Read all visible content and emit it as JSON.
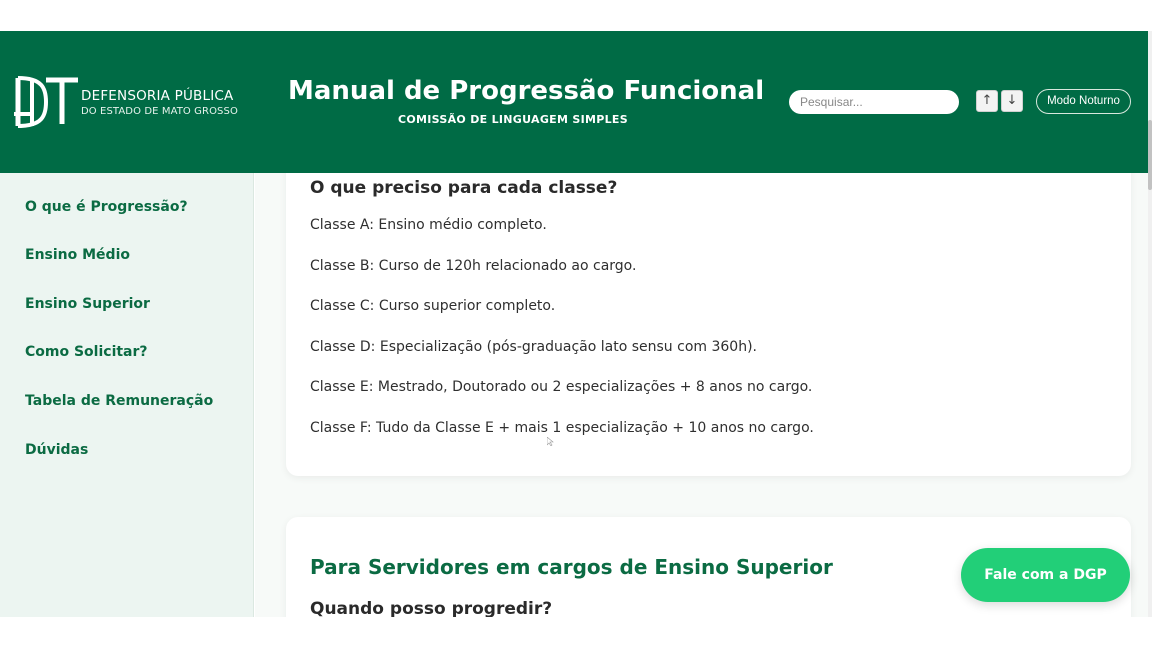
{
  "header": {
    "logo_line1": "DEFENSORIA PÚBLICA",
    "logo_line2": "DO ESTADO DE MATO GROSSO",
    "title": "Manual de Progressão Funcional",
    "subtitle": "COMISSÃO DE LINGUAGEM SIMPLES",
    "search_placeholder": "Pesquisar...",
    "up_label": "↑",
    "down_label": "↓",
    "night_mode_label": "Modo Noturno"
  },
  "sidebar": {
    "items": [
      {
        "label": "O que é Progressão?"
      },
      {
        "label": "Ensino Médio"
      },
      {
        "label": "Ensino Superior"
      },
      {
        "label": "Como Solicitar?"
      },
      {
        "label": "Tabela de Remuneração"
      },
      {
        "label": "Dúvidas"
      }
    ]
  },
  "main": {
    "card1": {
      "heading": "O que preciso para cada classe?",
      "items": [
        "Classe A: Ensino médio completo.",
        "Classe B: Curso de 120h relacionado ao cargo.",
        "Classe C: Curso superior completo.",
        "Classe D: Especialização (pós-graduação lato sensu com 360h).",
        "Classe E: Mestrado, Doutorado ou 2 especializações + 8 anos no cargo.",
        "Classe F: Tudo da Classe E + mais 1 especialização + 10 anos no cargo."
      ]
    },
    "card2": {
      "section_title": "Para Servidores em cargos de Ensino Superior",
      "heading": "Quando posso progredir?"
    }
  },
  "fab_label": "Fale com a DGP",
  "colors": {
    "header_green": "#006b45",
    "accent_green": "#0b6b43",
    "fab_green": "#22cf78",
    "sidebar_bg": "#ecf5f1"
  }
}
